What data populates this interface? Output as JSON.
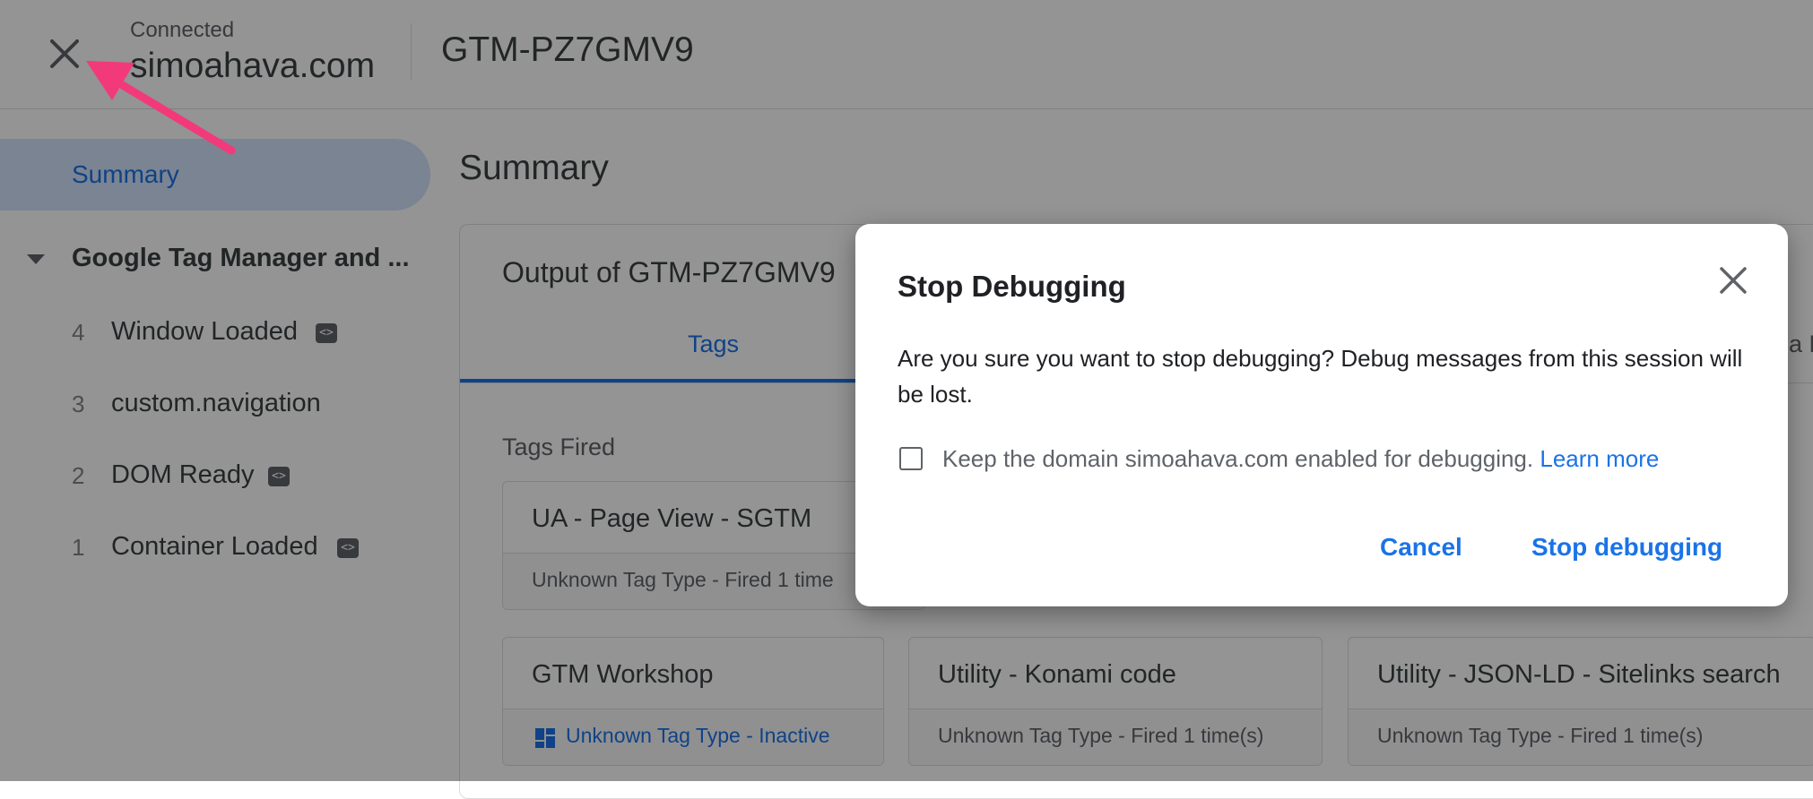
{
  "header": {
    "status": "Connected",
    "domain": "simoahava.com",
    "container_id": "GTM-PZ7GMV9",
    "close_icon": "close-icon"
  },
  "sidebar": {
    "summary_label": "Summary",
    "group_label": "Google Tag Manager and ...",
    "events": [
      {
        "num": "4",
        "label": "Window Loaded",
        "has_code_icon": true
      },
      {
        "num": "3",
        "label": "custom.navigation",
        "has_code_icon": false
      },
      {
        "num": "2",
        "label": "DOM Ready",
        "has_code_icon": true
      },
      {
        "num": "1",
        "label": "Container Loaded",
        "has_code_icon": true
      }
    ]
  },
  "main": {
    "title": "Summary",
    "output_title": "Output of GTM-PZ7GMV9",
    "tabs": [
      {
        "label": "Tags"
      },
      {
        "label": "a L"
      }
    ],
    "tags_fired_label": "Tags Fired",
    "tag_cards": [
      {
        "name": "UA - Page View - SGTM",
        "status": "Unknown Tag Type - Fired 1 time"
      },
      {
        "name": "GTM Workshop",
        "status": "Unknown Tag Type - Inactive"
      },
      {
        "name": "Utility - Konami code",
        "status": "Unknown Tag Type - Fired 1 time(s)"
      },
      {
        "name": "Utility - JSON-LD - Sitelinks search",
        "status": "Unknown Tag Type - Fired 1 time(s)"
      }
    ]
  },
  "dialog": {
    "title": "Stop Debugging",
    "message": "Are you sure you want to stop debugging? Debug messages from this session will be lost.",
    "checkbox_label": "Keep the domain simoahava.com enabled for debugging.",
    "learn_more": "Learn more",
    "cancel_label": "Cancel",
    "stop_label": "Stop debugging"
  },
  "colors": {
    "accent": "#1a73e8",
    "annotation_arrow": "#f23a7a",
    "scrim": "rgba(0,0,0,0.42)"
  }
}
